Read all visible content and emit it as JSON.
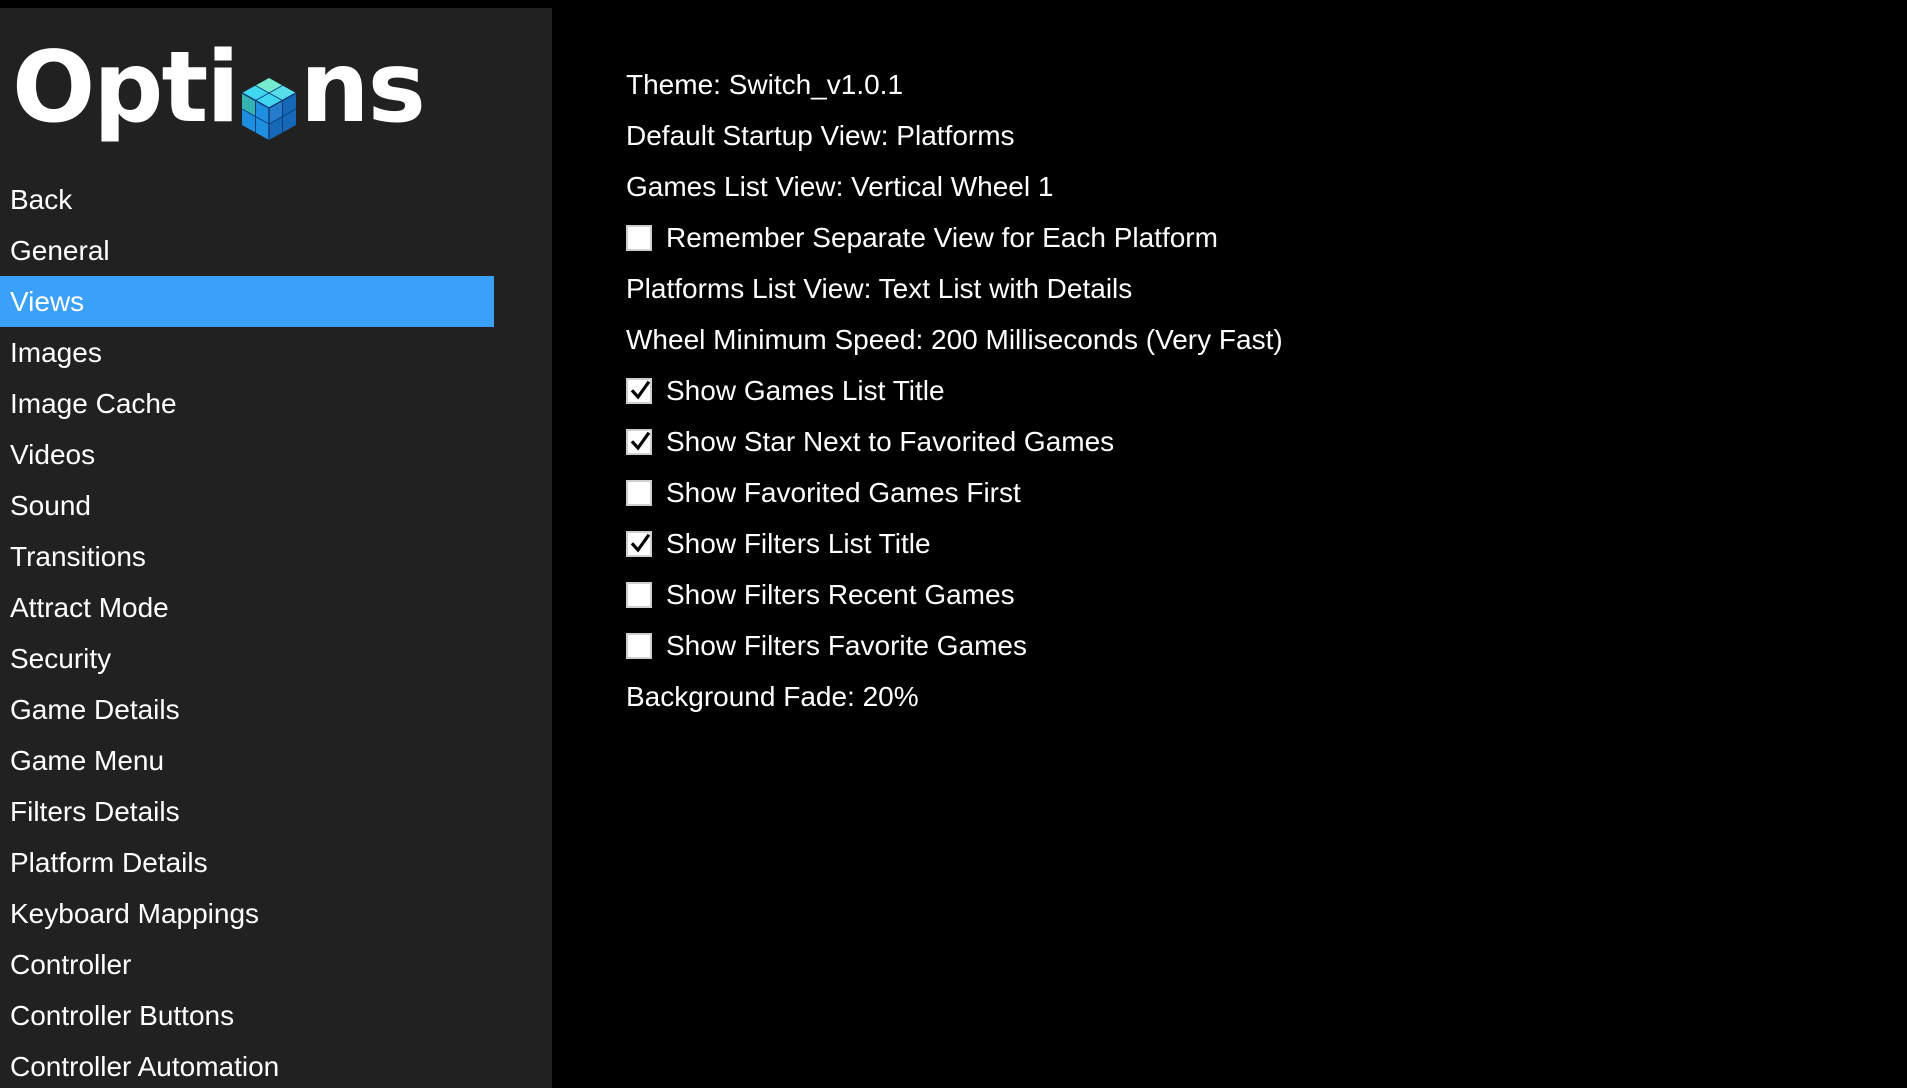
{
  "app": {
    "title_before": "Opti",
    "title_after": "ns",
    "logo_icon": "cube-logo-icon"
  },
  "sidebar": {
    "items": [
      {
        "label": "Back",
        "selected": false
      },
      {
        "label": "General",
        "selected": false
      },
      {
        "label": "Views",
        "selected": true
      },
      {
        "label": "Images",
        "selected": false
      },
      {
        "label": "Image Cache",
        "selected": false
      },
      {
        "label": "Videos",
        "selected": false
      },
      {
        "label": "Sound",
        "selected": false
      },
      {
        "label": "Transitions",
        "selected": false
      },
      {
        "label": "Attract Mode",
        "selected": false
      },
      {
        "label": "Security",
        "selected": false
      },
      {
        "label": "Game Details",
        "selected": false
      },
      {
        "label": "Game Menu",
        "selected": false
      },
      {
        "label": "Filters Details",
        "selected": false
      },
      {
        "label": "Platform Details",
        "selected": false
      },
      {
        "label": "Keyboard Mappings",
        "selected": false
      },
      {
        "label": "Controller",
        "selected": false
      },
      {
        "label": "Controller Buttons",
        "selected": false
      },
      {
        "label": "Controller Automation",
        "selected": false
      }
    ]
  },
  "views": {
    "options": [
      {
        "label": "Theme: Switch_v1.0.1",
        "type": "value"
      },
      {
        "label": "Default Startup View: Platforms",
        "type": "value"
      },
      {
        "label": "Games List View: Vertical Wheel 1",
        "type": "value"
      },
      {
        "label": "Remember Separate View for Each Platform",
        "type": "checkbox",
        "checked": false
      },
      {
        "label": "Platforms List View: Text List with Details",
        "type": "value"
      },
      {
        "label": "Wheel Minimum Speed: 200 Milliseconds (Very Fast)",
        "type": "value"
      },
      {
        "label": "Show Games List Title",
        "type": "checkbox",
        "checked": true
      },
      {
        "label": "Show Star Next to Favorited Games",
        "type": "checkbox",
        "checked": true
      },
      {
        "label": "Show Favorited Games First",
        "type": "checkbox",
        "checked": false
      },
      {
        "label": "Show Filters List Title",
        "type": "checkbox",
        "checked": true
      },
      {
        "label": "Show Filters Recent Games",
        "type": "checkbox",
        "checked": false
      },
      {
        "label": "Show Filters Favorite Games",
        "type": "checkbox",
        "checked": false
      },
      {
        "label": "Background Fade: 20%",
        "type": "value"
      }
    ]
  },
  "colors": {
    "sidebar_bg": "#212121",
    "selected_bg": "#3aa0fa",
    "page_bg": "#000000",
    "text": "#ffffff"
  }
}
